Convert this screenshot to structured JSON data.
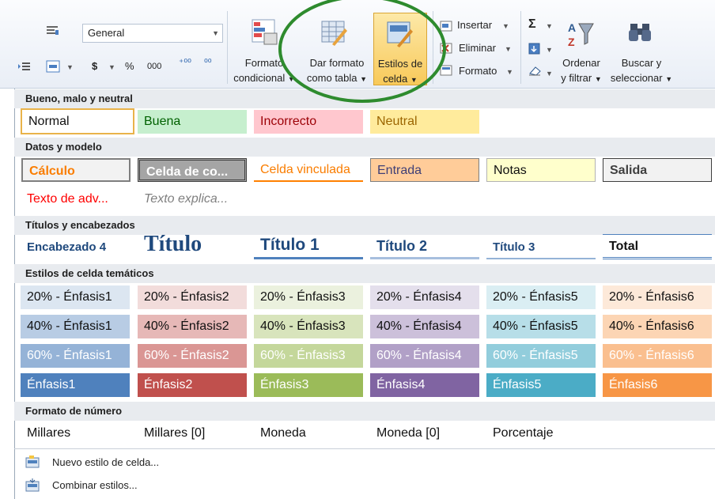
{
  "ribbon": {
    "number_format": "General",
    "currency_symbol": "$",
    "percent_symbol": "%",
    "thousands": "000",
    "dec_increase": "⁺⁰⁰",
    "dec_decrease": "⁰⁰",
    "cond_format": {
      "line1": "Formato",
      "line2": "condicional"
    },
    "format_table": {
      "line1": "Dar formato",
      "line2": "como tabla"
    },
    "cell_styles": {
      "line1": "Estilos de",
      "line2": "celda"
    },
    "insert": "Insertar",
    "delete": "Eliminar",
    "format": "Formato",
    "sigma": "Σ",
    "sort": {
      "line1": "Ordenar",
      "line2": "y filtrar"
    },
    "find": {
      "line1": "Buscar y",
      "line2": "seleccionar"
    }
  },
  "sections": {
    "good_bad": "Bueno, malo y neutral",
    "data_model": "Datos y modelo",
    "titles": "Títulos y encabezados",
    "themed": "Estilos de celda temáticos",
    "number_format": "Formato de número"
  },
  "good_bad": [
    "Normal",
    "Buena",
    "Incorrecto",
    "Neutral"
  ],
  "data_model": {
    "row1": [
      "Cálculo",
      "Celda de co...",
      "Celda vinculada",
      "Entrada",
      "Notas",
      "Salida"
    ],
    "row2": [
      "Texto de adv...",
      "Texto explica..."
    ]
  },
  "titles": [
    "Encabezado 4",
    "Título",
    "Título 1",
    "Título 2",
    "Título 3",
    "Total"
  ],
  "themed": {
    "row20": [
      "20% - Énfasis1",
      "20% - Énfasis2",
      "20% - Énfasis3",
      "20% - Énfasis4",
      "20% - Énfasis5",
      "20% - Énfasis6"
    ],
    "row40": [
      "40% - Énfasis1",
      "40% - Énfasis2",
      "40% - Énfasis3",
      "40% - Énfasis4",
      "40% - Énfasis5",
      "40% - Énfasis6"
    ],
    "row60": [
      "60% - Énfasis1",
      "60% - Énfasis2",
      "60% - Énfasis3",
      "60% - Énfasis4",
      "60% - Énfasis5",
      "60% - Énfasis6"
    ],
    "row100": [
      "Énfasis1",
      "Énfasis2",
      "Énfasis3",
      "Énfasis4",
      "Énfasis5",
      "Énfasis6"
    ]
  },
  "number_styles": [
    "Millares",
    "Millares [0]",
    "Moneda",
    "Moneda [0]",
    "Porcentaje"
  ],
  "menu": {
    "new_style": "Nuevo estilo de celda...",
    "merge_styles": "Combinar estilos..."
  },
  "colors": {
    "highlight_circle": "#2e8b2e",
    "accent1": "#4f81bd",
    "accent2": "#c0504d",
    "accent3": "#9bbb59",
    "accent4": "#8064a2",
    "accent5": "#4bacc6",
    "accent6": "#f79646"
  }
}
